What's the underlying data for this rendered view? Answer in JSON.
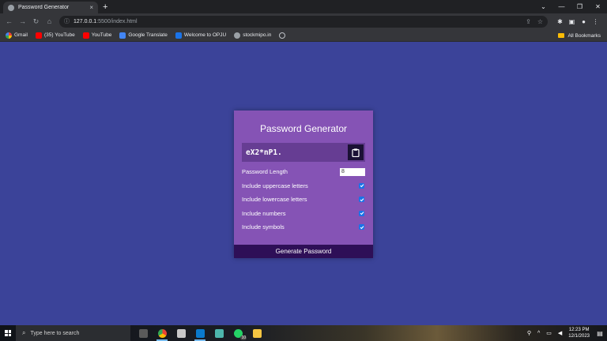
{
  "browser": {
    "tab_title": "Password Generator",
    "tab_close": "×",
    "new_tab": "+",
    "url_host": "127.0.0.1",
    "url_path": ":5500/index.html",
    "bookmarks": [
      {
        "label": "Gmail",
        "icon": "google-icon"
      },
      {
        "label": "(35) YouTube",
        "icon": "youtube-icon"
      },
      {
        "label": "YouTube",
        "icon": "youtube-icon"
      },
      {
        "label": "Google Translate",
        "icon": "google-translate-icon"
      },
      {
        "label": "Welcome to OPJU",
        "icon": "opju-icon"
      },
      {
        "label": "stockmipo.in",
        "icon": "wordpress-icon"
      }
    ],
    "all_bookmarks": "All Bookmarks"
  },
  "generator": {
    "title": "Password Generator",
    "result": "eX2*nP1.",
    "length_label": "Password Length",
    "length_value": "8",
    "options": [
      {
        "label": "Include uppercase letters",
        "checked": true
      },
      {
        "label": "Include lowercase letters",
        "checked": true
      },
      {
        "label": "Include numbers",
        "checked": true
      },
      {
        "label": "Include symbols",
        "checked": true
      }
    ],
    "generate_label": "Generate Password"
  },
  "taskbar": {
    "search_placeholder": "Type here to search",
    "time": "12:23 PM",
    "date": "12/1/2023",
    "whatsapp_badge": "10"
  },
  "colors": {
    "page_bg": "#3b4399",
    "card_bg": "#8553b5",
    "result_bg": "#663d93",
    "button_bg": "#2e0f57",
    "checkbox": "#1a73e8"
  }
}
